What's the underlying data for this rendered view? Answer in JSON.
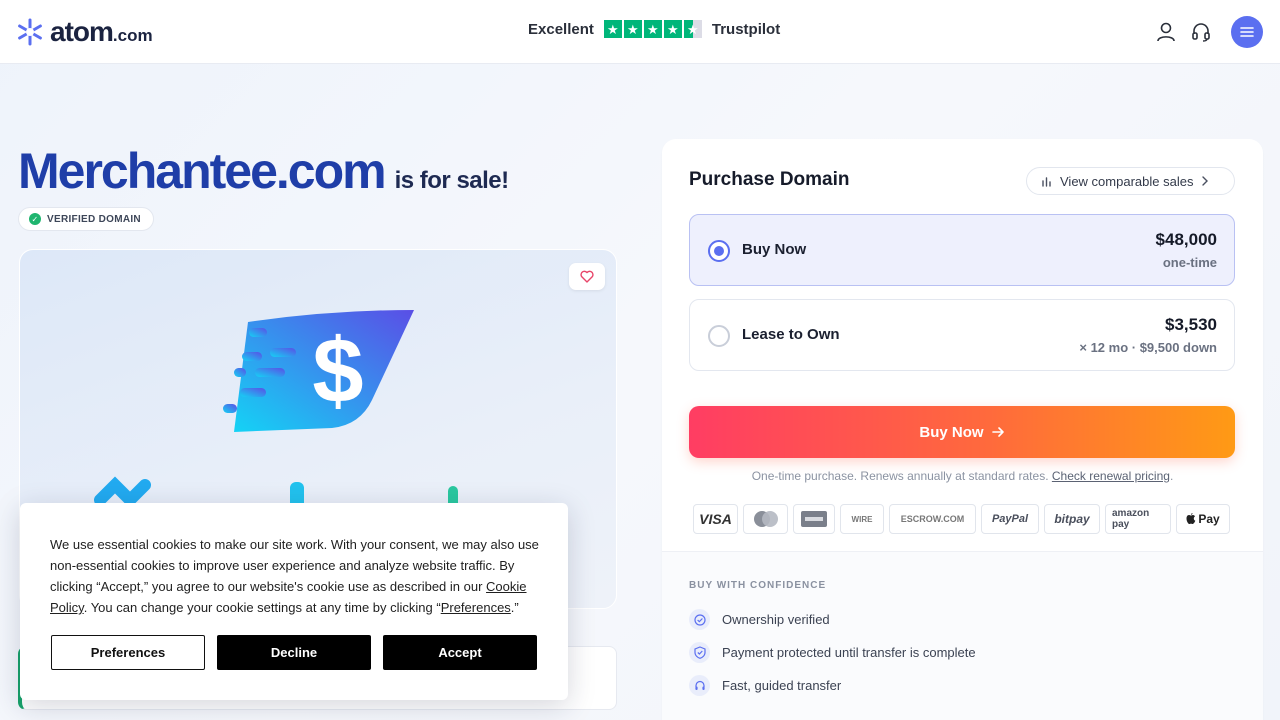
{
  "header": {
    "logo_main": "atom",
    "logo_suffix": ".com",
    "trust_rating": "Excellent",
    "trust_name": "Trustpilot",
    "star_color": "#00b67a"
  },
  "hero": {
    "domain": "Merchantee.com",
    "for_sale": "is for sale!",
    "verified_badge": "VERIFIED DOMAIN"
  },
  "cookie": {
    "text_before_link1": "We use essential cookies to make our site work. With your consent, we may also use non-essential cookies to improve user experience and analyze website traffic. By clicking “Accept,” you agree to our website's cookie use as described in our ",
    "link1": "Cookie Policy",
    "text_between": ". You can change your cookie settings at any time by clicking “",
    "link2": "Preferences",
    "text_after": ".”",
    "btn_preferences": "Preferences",
    "btn_decline": "Decline",
    "btn_accept": "Accept"
  },
  "purchase": {
    "title": "Purchase Domain",
    "comparable": "View comparable sales",
    "options": [
      {
        "label": "Buy Now",
        "price": "$48,000",
        "sub": "one-time",
        "selected": true
      },
      {
        "label": "Lease to Own",
        "price": "$3,530",
        "sub": "× 12 mo · $9,500 down",
        "selected": false
      }
    ],
    "buy_button": "Buy Now",
    "note": "One-time purchase. Renews annually at standard rates.",
    "note_link": "Check renewal pricing",
    "note_end": ".",
    "payments": [
      "VISA",
      "MasterCard",
      "AMEX",
      "WIRE",
      "ESCROW.COM",
      "PayPal",
      "bitpay",
      "amazon pay",
      "Pay"
    ],
    "confidence_title": "BUY WITH CONFIDENCE",
    "confidence": [
      "Ownership verified",
      "Payment protected until transfer is complete",
      "Fast, guided transfer"
    ],
    "accent": "#5b6ff0"
  }
}
